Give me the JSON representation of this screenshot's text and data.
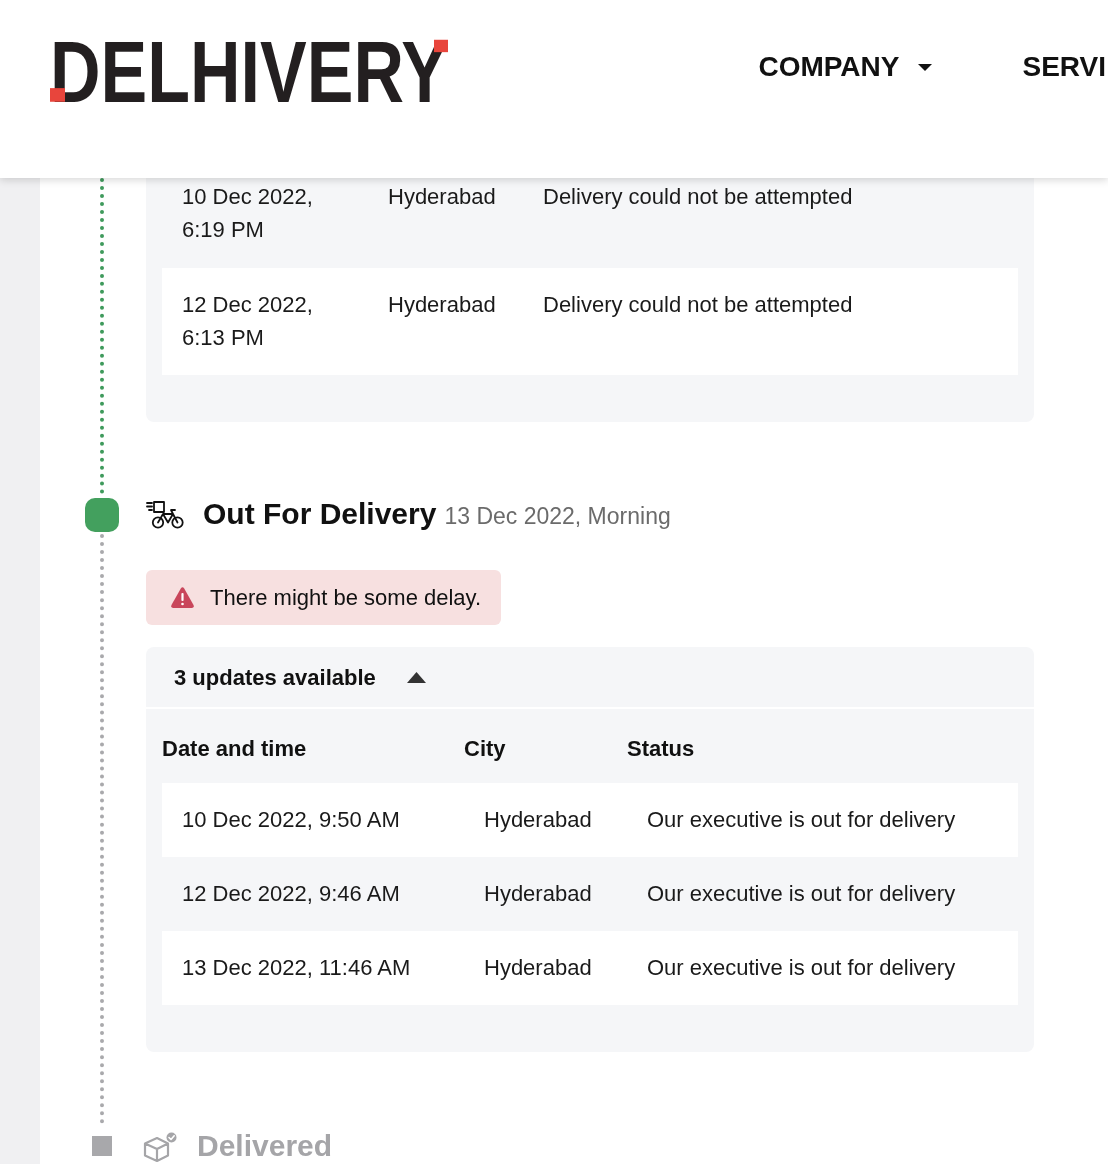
{
  "header": {
    "logo": "DELHIVERY",
    "nav": [
      {
        "label": "COMPANY",
        "dropdown": true
      },
      {
        "label": "SERVI",
        "dropdown": false
      }
    ]
  },
  "timeline": [
    {
      "kind": "updates",
      "done": true,
      "updates": {
        "rows": [
          {
            "date_time": "10 Dec 2022, 6:19 PM",
            "city": "Hyderabad",
            "status": "Delivery could not be attempted"
          },
          {
            "date_time": "12 Dec 2022, 6:13 PM",
            "city": "Hyderabad",
            "status": "Delivery could not be attempted"
          }
        ]
      }
    },
    {
      "kind": "out_for_delivery",
      "done": false,
      "current": true,
      "title": "Out For Delivery",
      "date": "13 Dec 2022, Morning",
      "alert": "There might be some delay.",
      "updates": {
        "summary": "3 updates available",
        "expanded": true,
        "columns": [
          "Date and time",
          "City",
          "Status"
        ],
        "rows": [
          {
            "date_time": "10 Dec 2022, 9:50 AM",
            "city": "Hyderabad",
            "status": "Our executive is out for delivery"
          },
          {
            "date_time": "12 Dec 2022, 9:46 AM",
            "city": "Hyderabad",
            "status": "Our executive is out for delivery"
          },
          {
            "date_time": "13 Dec 2022, 11:46 AM",
            "city": "Hyderabad",
            "status": "Our executive is out for delivery"
          }
        ]
      }
    },
    {
      "kind": "delivered",
      "done": false,
      "current": false,
      "title": "Delivered"
    }
  ]
}
